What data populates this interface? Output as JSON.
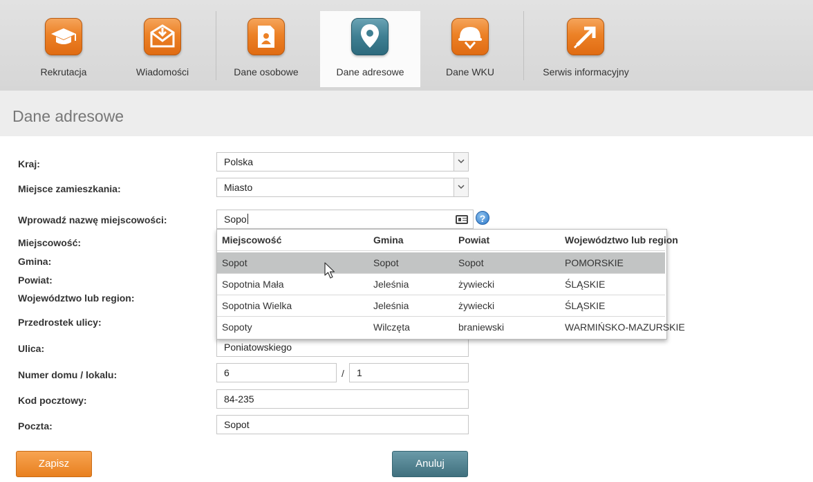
{
  "nav": {
    "items": [
      {
        "label": "Rekrutacja",
        "icon": "graduation-cap-icon"
      },
      {
        "label": "Wiadomości",
        "icon": "envelope-icon"
      },
      {
        "label": "Dane osobowe",
        "icon": "person-card-icon"
      },
      {
        "label": "Dane adresowe",
        "icon": "location-pin-icon",
        "active": true
      },
      {
        "label": "Dane WKU",
        "icon": "helmet-icon"
      },
      {
        "label": "Serwis informacyjny",
        "icon": "external-arrow-icon"
      }
    ]
  },
  "page": {
    "title": "Dane adresowe"
  },
  "form": {
    "kraj": {
      "label": "Kraj:",
      "value": "Polska"
    },
    "miejsce": {
      "label": "Miejsce zamieszkania:",
      "value": "Miasto"
    },
    "search": {
      "label": "Wprowadź nazwę miejscowości:",
      "value": "Sopo"
    },
    "miejscowosc": {
      "label": "Miejscowość:"
    },
    "gmina": {
      "label": "Gmina:"
    },
    "powiat": {
      "label": "Powiat:"
    },
    "wojewodztwo": {
      "label": "Województwo lub region:"
    },
    "przedrostek": {
      "label": "Przedrostek ulicy:"
    },
    "ulica": {
      "label": "Ulica:",
      "value": "Poniatowskiego"
    },
    "numer": {
      "label": "Numer domu / lokalu:",
      "house": "6",
      "separator": "/",
      "flat": "1"
    },
    "kod": {
      "label": "Kod pocztowy:",
      "value": "84-235"
    },
    "poczta": {
      "label": "Poczta:",
      "value": "Sopot"
    }
  },
  "suggestions": {
    "headers": [
      "Miejscowość",
      "Gmina",
      "Powiat",
      "Województwo lub region"
    ],
    "rows": [
      [
        "Sopot",
        "Sopot",
        "Sopot",
        "POMORSKIE"
      ],
      [
        "Sopotnia Mała",
        "Jeleśnia",
        "żywiecki",
        "ŚLĄSKIE"
      ],
      [
        "Sopotnia Wielka",
        "Jeleśnia",
        "żywiecki",
        "ŚLĄSKIE"
      ],
      [
        "Sopoty",
        "Wilczęta",
        "braniewski",
        "WARMIŃSKO-MAZURSKIE"
      ]
    ],
    "selected_index": 0
  },
  "buttons": {
    "save": "Zapisz",
    "cancel": "Anuluj"
  },
  "colors": {
    "accent_orange": "#ec8126",
    "accent_teal": "#3f7f92"
  }
}
